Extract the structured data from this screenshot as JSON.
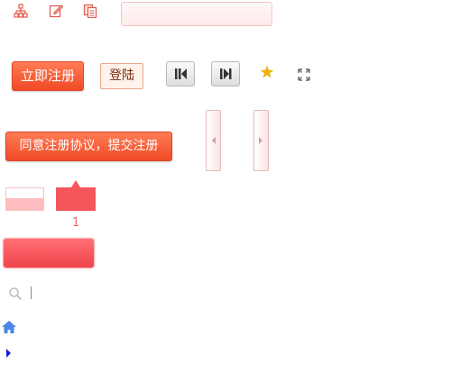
{
  "toolbar": {
    "icons": [
      "sitemap-icon",
      "edit-icon",
      "copy-icon"
    ],
    "search_value": ""
  },
  "buttons": {
    "register_now": "立即注册",
    "login": "登陆",
    "agree_submit": "同意注册协议，提交注册"
  },
  "media": {
    "prev_icon": "skip-previous-icon",
    "next_icon": "skip-next-icon",
    "favorite_icon": "star-icon",
    "fullscreen_icon": "expand-icon"
  },
  "tabs": {
    "active_count": "1"
  },
  "colors": {
    "primary_orange": "#ef4a26",
    "tab_red": "#f4565c",
    "home_blue": "#4a86e8",
    "star_gold": "#f0b400"
  }
}
